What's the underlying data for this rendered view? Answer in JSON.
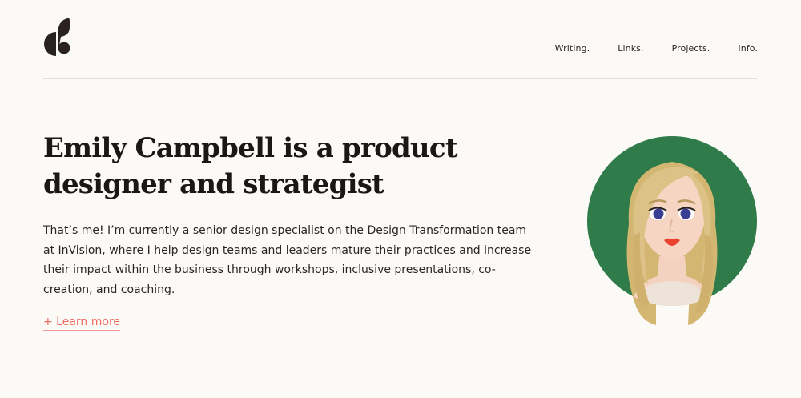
{
  "header": {
    "logo_icon": "brand-logo-icon",
    "nav": [
      {
        "label": "Writing."
      },
      {
        "label": "Links."
      },
      {
        "label": "Projects."
      },
      {
        "label": "Info."
      }
    ]
  },
  "hero": {
    "headline": "Emily Campbell is a product designer and strategist",
    "bio": "That’s me! I’m currently a senior design specialist on the Design Transformation team at InVision, where I help design teams and leaders mature their practices and increase their impact within the business through workshops, inclusive presentations, co-creation, and coaching.",
    "cta_label": "+ Learn more",
    "avatar_icon": "portrait-illustration"
  },
  "colors": {
    "background": "#fbfaf6",
    "accent": "#ef6b60",
    "avatar_circle": "#2f7b4a",
    "hair": "#d9be7e",
    "text": "#1d1a1a"
  }
}
